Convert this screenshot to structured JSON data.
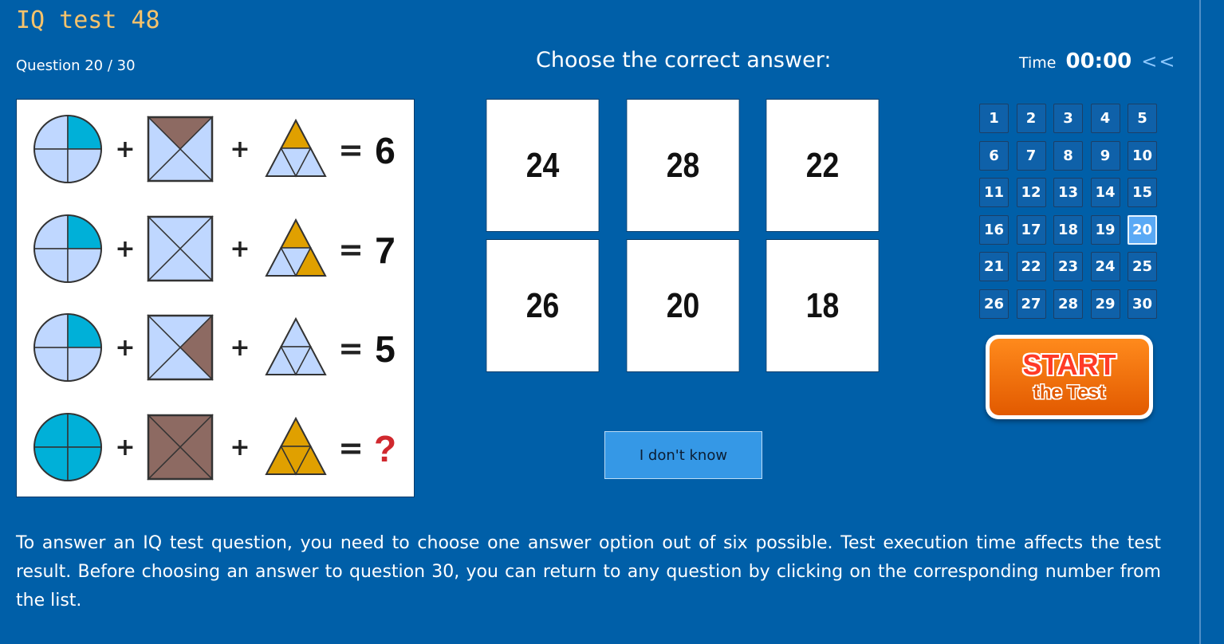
{
  "header": {
    "title": "IQ test 48",
    "question_counter": "Question 20 / 30",
    "prompt": "Choose the correct answer:",
    "time_label": "Time",
    "time_value": "00:00",
    "back_label": "<<"
  },
  "puzzle": {
    "colors": {
      "light_blue": "#bfd7ff",
      "cyan": "#00b0d8",
      "brown": "#8d6a62",
      "orange": "#e0a000"
    },
    "rows": [
      {
        "result": "6"
      },
      {
        "result": "7"
      },
      {
        "result": "5"
      },
      {
        "result": "?"
      }
    ],
    "plus_sign": "+",
    "equals_sign": "="
  },
  "answers": [
    "24",
    "28",
    "22",
    "26",
    "20",
    "18"
  ],
  "dont_know_label": "I don't know",
  "question_numbers": [
    "1",
    "2",
    "3",
    "4",
    "5",
    "6",
    "7",
    "8",
    "9",
    "10",
    "11",
    "12",
    "13",
    "14",
    "15",
    "16",
    "17",
    "18",
    "19",
    "20",
    "21",
    "22",
    "23",
    "24",
    "25",
    "26",
    "27",
    "28",
    "29",
    "30"
  ],
  "current_question": "20",
  "start_button": {
    "line1": "START",
    "line2": "the Test"
  },
  "description": "To answer an IQ test question, you need to choose one answer option out of six possible. Test execution time affects the test result. Before choosing an answer to question 30, you can return to any question by clicking on the corresponding number from the list."
}
